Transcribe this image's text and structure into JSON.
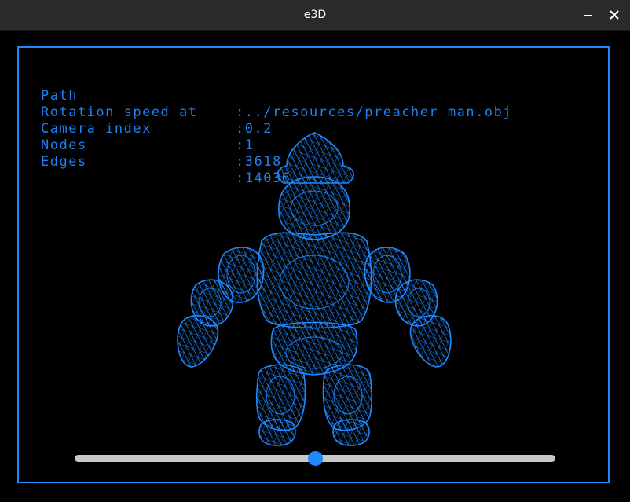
{
  "window": {
    "title": "e3D",
    "minimize_icon": "minimize-icon",
    "close_icon": "close-icon",
    "close_glyph": "✕"
  },
  "colors": {
    "accent": "#1e88ff",
    "background": "#000000",
    "titlebar": "#2a2a2a",
    "slider_track": "#c8c8c8"
  },
  "info": {
    "path_label": "Path",
    "path_value": ":../resources/preacher man.obj",
    "rotation_label": "Rotation speed at",
    "rotation_value": ":0.2",
    "camera_label": "Camera index",
    "camera_value": ":1",
    "nodes_label": "Nodes",
    "nodes_value": ":3618",
    "edges_label": "Edges",
    "edges_value": ":14036"
  },
  "slider": {
    "value": 0.5
  }
}
